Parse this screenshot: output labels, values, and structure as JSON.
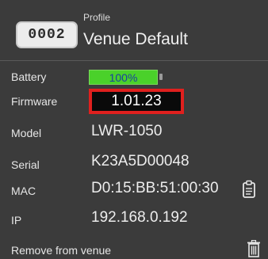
{
  "header": {
    "device_id": "0002",
    "profile_caption": "Profile",
    "profile_name": "Venue Default"
  },
  "battery": {
    "label": "Battery",
    "value": "100%",
    "level": 1.0,
    "fill_color": "#4ad12a"
  },
  "firmware": {
    "label": "Firmware",
    "value": "1.01.23",
    "highlight_color": "#e0201e"
  },
  "model": {
    "label": "Model",
    "value": "LWR-1050"
  },
  "serial": {
    "label": "Serial",
    "value": "K23A5D00048"
  },
  "mac": {
    "label": "MAC",
    "value": "D0:15:BB:51:00:30",
    "copy_icon": "clipboard-icon"
  },
  "ip": {
    "label": "IP",
    "value": "192.168.0.192"
  },
  "remove": {
    "label": "Remove from venue",
    "icon": "trash-icon"
  }
}
